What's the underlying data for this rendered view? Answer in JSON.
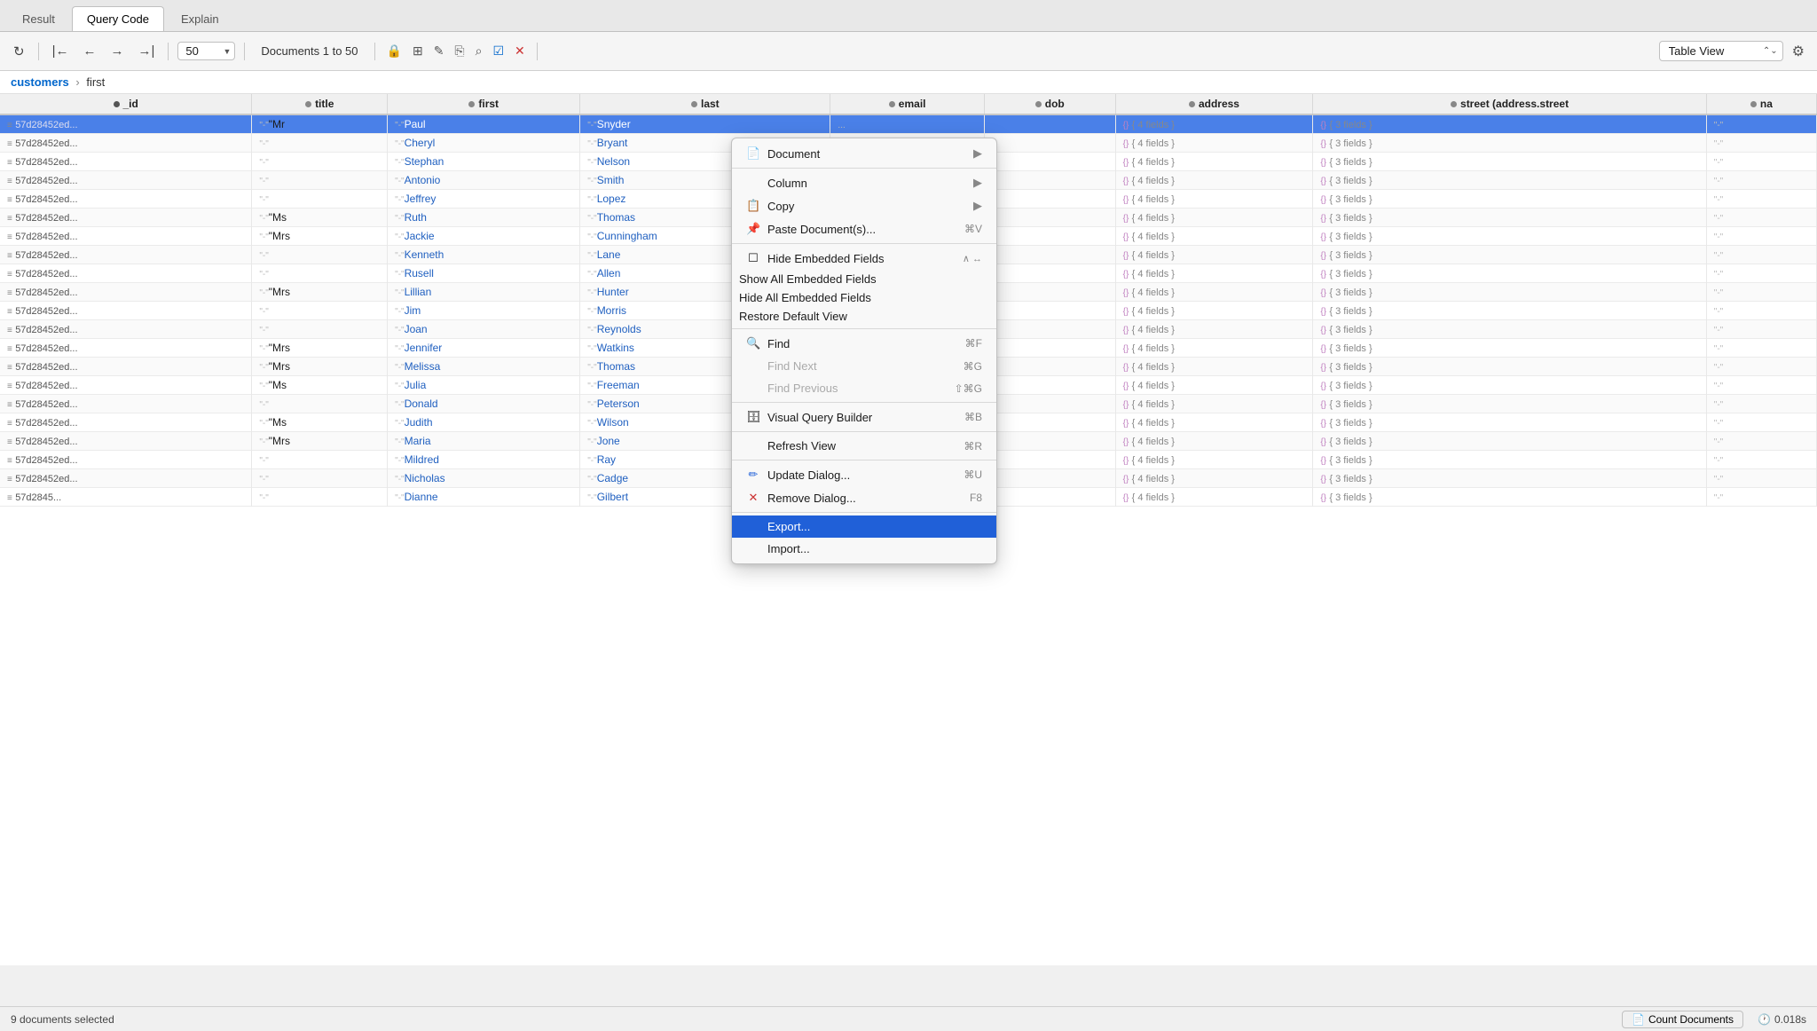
{
  "tabs": [
    {
      "label": "Result",
      "active": false
    },
    {
      "label": "Query Code",
      "active": true
    },
    {
      "label": "Explain",
      "active": false
    }
  ],
  "toolbar": {
    "limit_value": "50",
    "doc_range": "Documents 1 to 50",
    "view_label": "Table View"
  },
  "breadcrumb": {
    "collection": "customers",
    "field": "first"
  },
  "columns": [
    {
      "label": "_id",
      "dot": "primary"
    },
    {
      "label": "title",
      "dot": "normal"
    },
    {
      "label": "first",
      "dot": "normal"
    },
    {
      "label": "last",
      "dot": "normal"
    },
    {
      "label": "email",
      "dot": "normal"
    },
    {
      "label": "dob",
      "dot": "normal"
    },
    {
      "label": "address",
      "dot": "normal"
    },
    {
      "label": "street (address.street",
      "dot": "normal"
    },
    {
      "label": "na",
      "dot": "normal"
    }
  ],
  "rows": [
    {
      "id": "57d28452ed...",
      "title": "\"Mr",
      "first": "Paul",
      "last": "Snyder",
      "selected": true,
      "has_email": true,
      "addr": "{ 4 fields }",
      "street": "{ 3 fields }"
    },
    {
      "id": "57d28452ed...",
      "title": "",
      "first": "Cheryl",
      "last": "Bryant",
      "has_email": true,
      "addr": "{ 4 fields }",
      "street": "{ 3 fields }"
    },
    {
      "id": "57d28452ed...",
      "title": "",
      "first": "Stephan",
      "last": "Nelson",
      "has_email": true,
      "addr": "{ 4 fields }",
      "street": "{ 3 fields }"
    },
    {
      "id": "57d28452ed...",
      "title": "",
      "first": "Antonio",
      "last": "Smith",
      "has_email": true,
      "addr": "{ 4 fields }",
      "street": "{ 3 fields }"
    },
    {
      "id": "57d28452ed...",
      "title": "",
      "first": "Jeffrey",
      "last": "Lopez",
      "has_email": true,
      "addr": "{ 4 fields }",
      "street": "{ 3 fields }"
    },
    {
      "id": "57d28452ed...",
      "title": "\"Ms",
      "first": "Ruth",
      "last": "Thomas",
      "has_email": true,
      "addr": "{ 4 fields }",
      "street": "{ 3 fields }"
    },
    {
      "id": "57d28452ed...",
      "title": "\"Mrs",
      "first": "Jackie",
      "last": "Cunningham",
      "has_email": true,
      "addr": "{ 4 fields }",
      "street": "{ 3 fields }"
    },
    {
      "id": "57d28452ed...",
      "title": "",
      "first": "Kenneth",
      "last": "Lane",
      "has_email": true,
      "addr": "{ 4 fields }",
      "street": "{ 3 fields }"
    },
    {
      "id": "57d28452ed...",
      "title": "",
      "first": "Rusell",
      "last": "Allen",
      "has_email": true,
      "addr": "{ 4 fields }",
      "street": "{ 3 fields }"
    },
    {
      "id": "57d28452ed...",
      "title": "\"Mrs",
      "first": "Lillian",
      "last": "Hunter",
      "has_email": false,
      "addr": "{ 4 fields }",
      "street": "{ 3 fields }"
    },
    {
      "id": "57d28452ed...",
      "title": "",
      "first": "Jim",
      "last": "Morris",
      "has_email": false,
      "addr": "{ 4 fields }",
      "street": "{ 3 fields }"
    },
    {
      "id": "57d28452ed...",
      "title": "",
      "first": "Joan",
      "last": "Reynolds",
      "has_email": false,
      "addr": "{ 4 fields }",
      "street": "{ 3 fields }"
    },
    {
      "id": "57d28452ed...",
      "title": "\"Mrs",
      "first": "Jennifer",
      "last": "Watkins",
      "has_email": false,
      "addr": "{ 4 fields }",
      "street": "{ 3 fields }"
    },
    {
      "id": "57d28452ed...",
      "title": "\"Mrs",
      "first": "Melissa",
      "last": "Thomas",
      "has_email": false,
      "addr": "{ 4 fields }",
      "street": "{ 3 fields }"
    },
    {
      "id": "57d28452ed...",
      "title": "\"Ms",
      "first": "Julia",
      "last": "Freeman",
      "has_email": false,
      "addr": "{ 4 fields }",
      "street": "{ 3 fields }"
    },
    {
      "id": "57d28452ed...",
      "title": "",
      "first": "Donald",
      "last": "Peterson",
      "has_email": false,
      "addr": "{ 4 fields }",
      "street": "{ 3 fields }"
    },
    {
      "id": "57d28452ed...",
      "title": "\"Ms",
      "first": "Judith",
      "last": "Wilson",
      "has_email": false,
      "addr": "{ 4 fields }",
      "street": "{ 3 fields }"
    },
    {
      "id": "57d28452ed...",
      "title": "\"Mrs",
      "first": "Maria",
      "last": "Jone",
      "has_email": false,
      "addr": "{ 4 fields }",
      "street": "{ 3 fields }"
    },
    {
      "id": "57d28452ed...",
      "title": "",
      "first": "Mildred",
      "last": "Ray",
      "has_email": false,
      "addr": "{ 4 fields }",
      "street": "{ 3 fields }"
    },
    {
      "id": "57d28452ed...",
      "title": "",
      "first": "Nicholas",
      "last": "Cadge",
      "has_email": false,
      "addr": "{ 4 fields }",
      "street": "{ 3 fields }"
    },
    {
      "id": "57d2845...",
      "title": "",
      "first": "Dianne",
      "last": "Gilbert",
      "has_email": false,
      "addr": "{ 4 fields }",
      "street": "{ 3 fields }"
    }
  ],
  "context_menu": {
    "items": [
      {
        "type": "item",
        "icon": "📄",
        "label": "Document",
        "has_arrow": true,
        "shortcut": ""
      },
      {
        "type": "separator"
      },
      {
        "type": "item",
        "icon": "",
        "label": "Column",
        "has_arrow": true,
        "shortcut": ""
      },
      {
        "type": "item",
        "icon": "📋",
        "label": "Copy",
        "has_arrow": true,
        "shortcut": ""
      },
      {
        "type": "item",
        "icon": "📌",
        "label": "Paste Document(s)...",
        "has_arrow": false,
        "shortcut": "⌘V"
      },
      {
        "type": "separator"
      },
      {
        "type": "item",
        "icon": "☐",
        "label": "Hide Embedded Fields",
        "collapse": true,
        "shortcut": ""
      },
      {
        "type": "subitem",
        "label": "Show All Embedded Fields"
      },
      {
        "type": "subitem",
        "label": "Hide All Embedded Fields"
      },
      {
        "type": "subitem",
        "label": "Restore Default View"
      },
      {
        "type": "separator"
      },
      {
        "type": "item",
        "icon": "🔍",
        "label": "Find",
        "shortcut": "⌘F"
      },
      {
        "type": "item",
        "icon": "",
        "label": "Find Next",
        "shortcut": "⌘G",
        "disabled": true
      },
      {
        "type": "item",
        "icon": "",
        "label": "Find Previous",
        "shortcut": "⇧⌘G",
        "disabled": true
      },
      {
        "type": "separator"
      },
      {
        "type": "item",
        "icon": "🗄",
        "label": "Visual Query Builder",
        "shortcut": "⌘B"
      },
      {
        "type": "separator"
      },
      {
        "type": "item",
        "icon": "",
        "label": "Refresh View",
        "shortcut": "⌘R"
      },
      {
        "type": "separator"
      },
      {
        "type": "item",
        "icon": "✏️",
        "label": "Update Dialog...",
        "shortcut": "⌘U"
      },
      {
        "type": "item",
        "icon": "✕",
        "label": "Remove Dialog...",
        "shortcut": "F8"
      },
      {
        "type": "separator"
      },
      {
        "type": "item",
        "icon": "",
        "label": "Export...",
        "highlighted": true
      },
      {
        "type": "item",
        "icon": "",
        "label": "Import..."
      }
    ]
  },
  "status_bar": {
    "selected": "9 documents selected",
    "count_btn": "Count Documents",
    "time": "0.018s"
  }
}
